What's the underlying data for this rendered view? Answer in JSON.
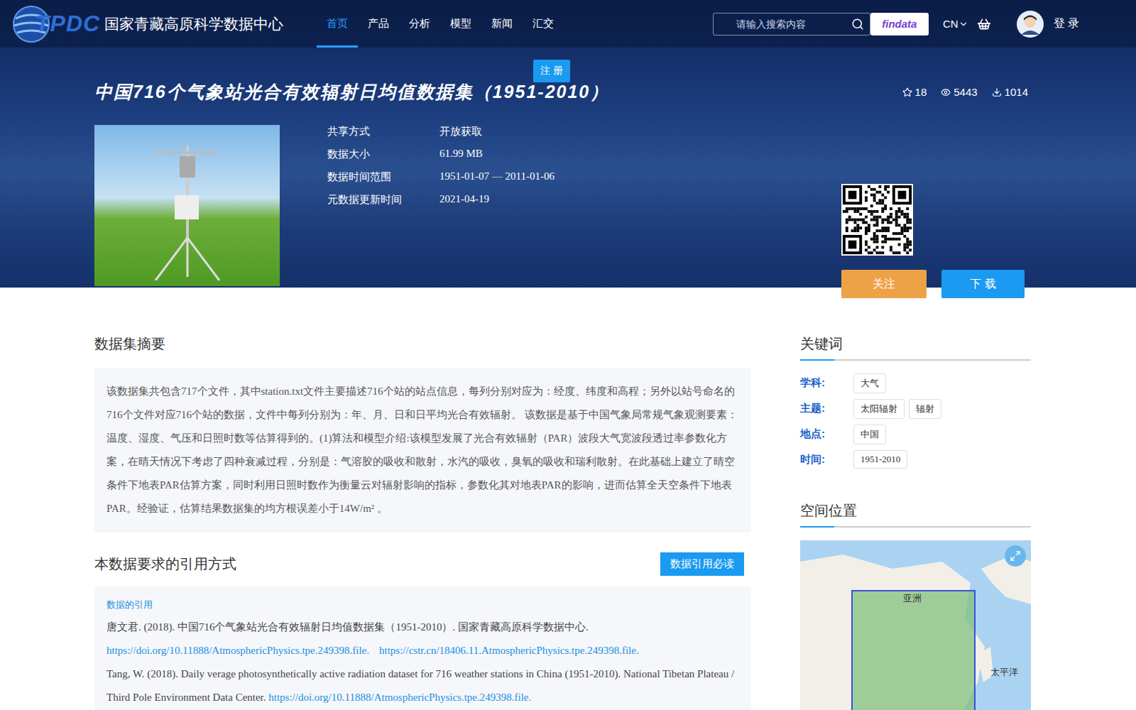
{
  "site": {
    "logo": "TPDC",
    "name": "国家青藏高原科学数据中心"
  },
  "nav": [
    {
      "label": "首页",
      "selected": true
    },
    {
      "label": "产品",
      "selected": false
    },
    {
      "label": "分析",
      "selected": false
    },
    {
      "label": "模型",
      "selected": false
    },
    {
      "label": "新闻",
      "selected": false
    },
    {
      "label": "汇交",
      "selected": false
    }
  ],
  "search": {
    "placeholder": "请输入搜索内容"
  },
  "findata": "findata",
  "language": "CN",
  "login": "登 录",
  "register": "注 册",
  "dataset": {
    "title": "中国716个气象站光合有效辐射日均值数据集（1951-2010）",
    "stats": {
      "stars": "18",
      "views": "5443",
      "downloads": "1014"
    },
    "info": [
      {
        "label": "共享方式",
        "value": "开放获取"
      },
      {
        "label": "数据大小",
        "value": "61.99 MB"
      },
      {
        "label": "数据时间范围",
        "value": "1951-01-07 — 2011-01-06"
      },
      {
        "label": "元数据更新时间",
        "value": "2021-04-19"
      }
    ],
    "follow": "关注",
    "download": "下 载"
  },
  "abstract": {
    "heading": "数据集摘要",
    "text": "该数据集共包含717个文件，其中station.txt文件主要描述716个站的站点信息，每列分别对应为：经度、纬度和高程；另外以站号命名的716个文件对应716个站的数据，文件中每列分别为：年、月、日和日平均光合有效辐射。 该数据是基于中国气象局常规气象观测要素：温度、湿度、气压和日照时数等估算得到的。(1)算法和模型介绍:该模型发展了光合有效辐射（PAR）波段大气宽波段透过率参数化方案，在晴天情况下考虑了四种衰减过程，分别是：气溶胶的吸收和散射，水汽的吸收，臭氧的吸收和瑞利散射。在此基础上建立了晴空条件下地表PAR估算方案，同时利用日照时数作为衡量云对辐射影响的指标，参数化其对地表PAR的影响，进而估算全天空条件下地表PAR。经验证，估算结果数据集的均方根误差小于14W/m² 。"
  },
  "citation": {
    "heading": "本数据要求的引用方式",
    "button": "数据引用必读",
    "subheading": "数据的引用",
    "chinese": "唐文君. (2018). 中国716个气象站光合有效辐射日均值数据集（1951-2010）. 国家青藏高原科学数据中心.",
    "links": [
      "https://doi.org/10.11888/AtmosphericPhysics.tpe.249398.file.",
      "https://cstr.cn/18406.11.AtmosphericPhysics.tpe.249398.file."
    ],
    "english": "Tang, W. (2018). Daily verage photosynthetically active radiation dataset for 716 weather stations in China (1951-2010). National Tibetan Plateau / Third Pole Environment Data Center.",
    "english_link": "https://doi.org/10.11888/AtmosphericPhysics.tpe.249398.file."
  },
  "keywords": {
    "heading": "关键词",
    "groups": [
      {
        "label": "学科:",
        "tags": [
          "大气"
        ]
      },
      {
        "label": "主题:",
        "tags": [
          "太阳辐射",
          "辐射"
        ]
      },
      {
        "label": "地点:",
        "tags": [
          "中国"
        ]
      },
      {
        "label": "时间:",
        "tags": [
          "1951-2010"
        ]
      }
    ]
  },
  "map": {
    "heading": "空间位置",
    "labels": [
      "亚洲",
      "太平洋"
    ]
  }
}
